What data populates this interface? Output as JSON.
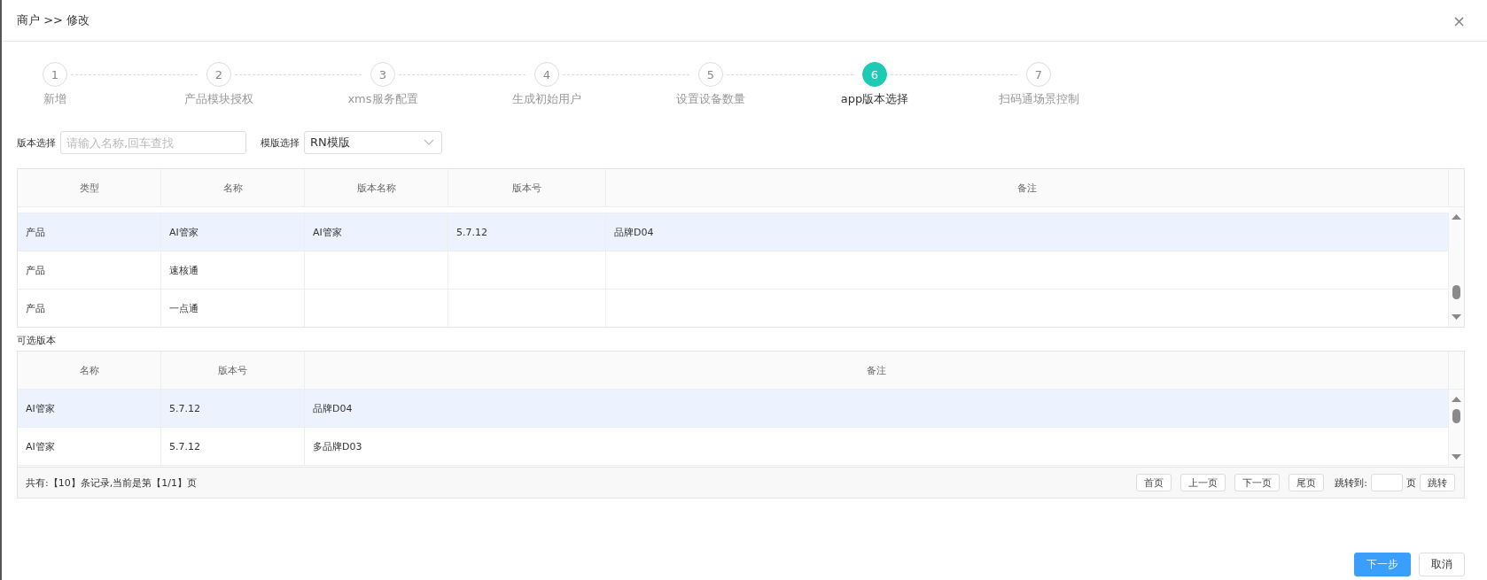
{
  "dialog": {
    "title": "商户 >> 修改",
    "close": "×"
  },
  "steps": [
    {
      "number": "1",
      "label": "新增",
      "selected": false
    },
    {
      "number": "2",
      "label": "产品模块授权",
      "selected": false
    },
    {
      "number": "3",
      "label": "xms服务配置",
      "selected": false
    },
    {
      "number": "4",
      "label": "生成初始用户",
      "selected": false
    },
    {
      "number": "5",
      "label": "设置设备数量",
      "selected": false
    },
    {
      "number": "6",
      "label": "app版本选择",
      "selected": true
    },
    {
      "number": "7",
      "label": "扫码通场景控制",
      "selected": false
    }
  ],
  "filters": {
    "version_label": "版本选择",
    "version_placeholder": "请输入名称,回车查找",
    "template_label": "模版选择",
    "template_value": "RN模版"
  },
  "selected_table": {
    "columns": [
      "类型",
      "名称",
      "版本名称",
      "版本号",
      "备注"
    ],
    "rows": [
      {
        "cells": [
          "产品",
          "AI管家",
          "AI管家",
          "5.7.12",
          "品牌D04"
        ],
        "selected": true
      },
      {
        "cells": [
          "产品",
          "速核通",
          "",
          "",
          ""
        ],
        "selected": false
      },
      {
        "cells": [
          "产品",
          "一点通",
          "",
          "",
          ""
        ],
        "selected": false
      }
    ]
  },
  "available_label": "可选版本",
  "available_table": {
    "columns": [
      "名称",
      "版本号",
      "备注"
    ],
    "rows": [
      {
        "cells": [
          "AI管家",
          "5.7.12",
          "品牌D04"
        ],
        "selected": true
      },
      {
        "cells": [
          "AI管家",
          "5.7.12",
          "多品牌D03"
        ],
        "selected": false
      }
    ]
  },
  "pager": {
    "summary": "共有:【10】条记录,当前是第【1/1】页",
    "buttons": [
      "首页",
      "上一页",
      "下一页",
      "尾页"
    ],
    "jump_label": "跳转到:",
    "page_unit": "页",
    "jump_button": "跳转"
  },
  "footer": {
    "buttons": [
      {
        "label": "下一步",
        "kind": "primary"
      },
      {
        "label": "取消",
        "kind": "default"
      }
    ]
  }
}
